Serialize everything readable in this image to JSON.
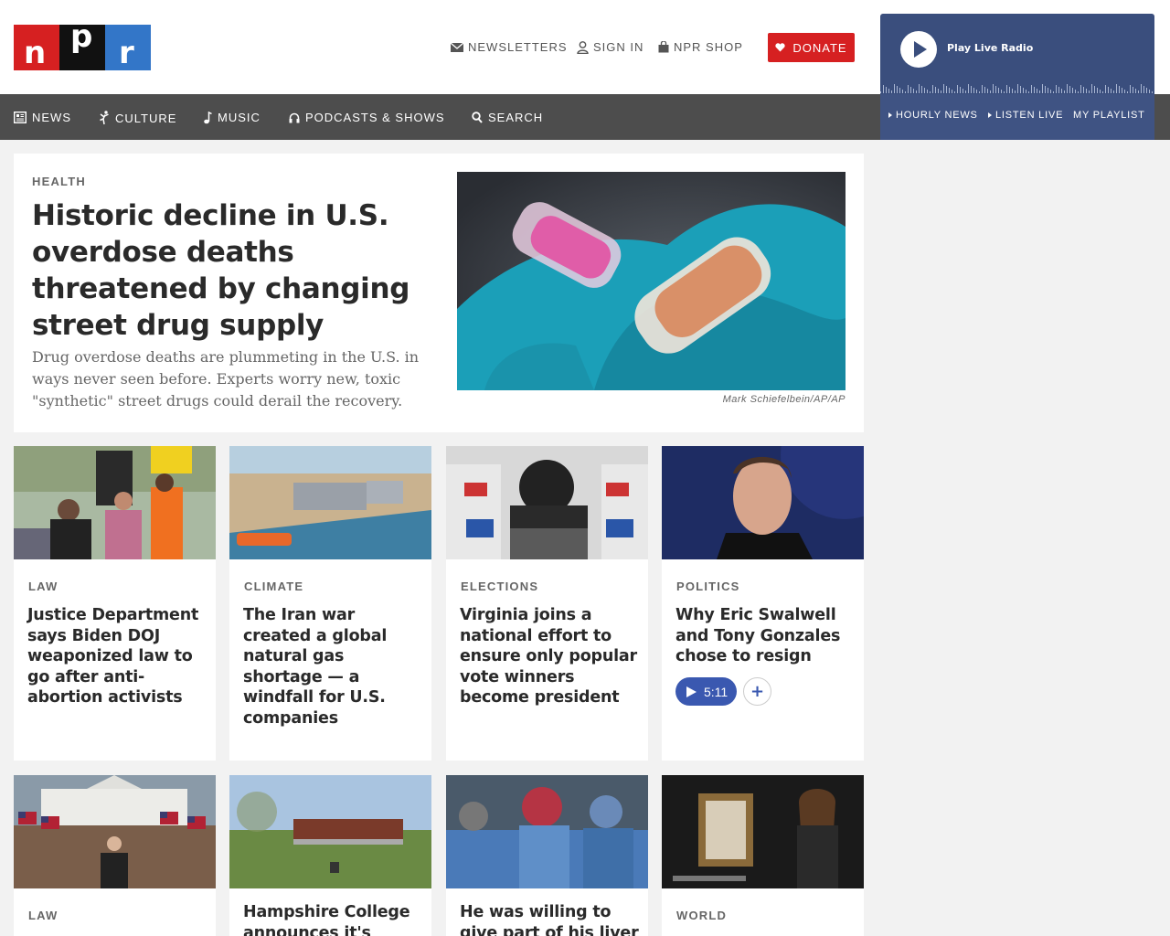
{
  "header": {
    "logo_letters": [
      "n",
      "p",
      "r"
    ],
    "newsletters": "NEWSLETTERS",
    "sign_in": "SIGN IN",
    "shop": "NPR SHOP",
    "donate": "DONATE"
  },
  "nav": {
    "items": [
      {
        "label": "NEWS",
        "icon": "news-icon"
      },
      {
        "label": "CULTURE",
        "icon": "culture-icon"
      },
      {
        "label": "MUSIC",
        "icon": "music-note-icon"
      },
      {
        "label": "PODCASTS & SHOWS",
        "icon": "headphones-icon"
      },
      {
        "label": "SEARCH",
        "icon": "search-icon"
      }
    ]
  },
  "player": {
    "play_label": "Play Live Radio",
    "links": [
      "HOURLY NEWS",
      "LISTEN LIVE",
      "MY PLAYLIST"
    ]
  },
  "hero": {
    "slug": "HEALTH",
    "title": "Historic decline in U.S. overdose deaths threatened by changing street drug supply",
    "teaser": "Drug overdose deaths are plummeting in the U.S. in ways never seen before. Experts worry new, toxic \"synthetic\" street drugs could derail the recovery.",
    "credit": "Mark Schiefelbein/AP/AP"
  },
  "cards": [
    {
      "slug": "LAW",
      "title": "Justice Department says Biden DOJ weaponized law to go after anti-abortion activists"
    },
    {
      "slug": "CLIMATE",
      "title": "The Iran war created a global natural gas shortage — a windfall for U.S. companies"
    },
    {
      "slug": "ELECTIONS",
      "title": "Virginia joins a national effort to ensure only popular vote winners become president"
    },
    {
      "slug": "POLITICS",
      "title": "Why Eric Swalwell and Tony Gonzales chose to resign",
      "audio_duration": "5:11"
    },
    {
      "slug": "LAW",
      "title": ""
    },
    {
      "slug": "",
      "title": "Hampshire College announces it's closing"
    },
    {
      "slug": "",
      "title": "He was willing to give part of his liver to a"
    },
    {
      "slug": "WORLD",
      "title": ""
    }
  ],
  "colors": {
    "brand_red": "#d62021",
    "nav_bg": "#4d4d4d",
    "player_bg": "#3a4e7d",
    "audio_blue": "#3a58b0"
  }
}
